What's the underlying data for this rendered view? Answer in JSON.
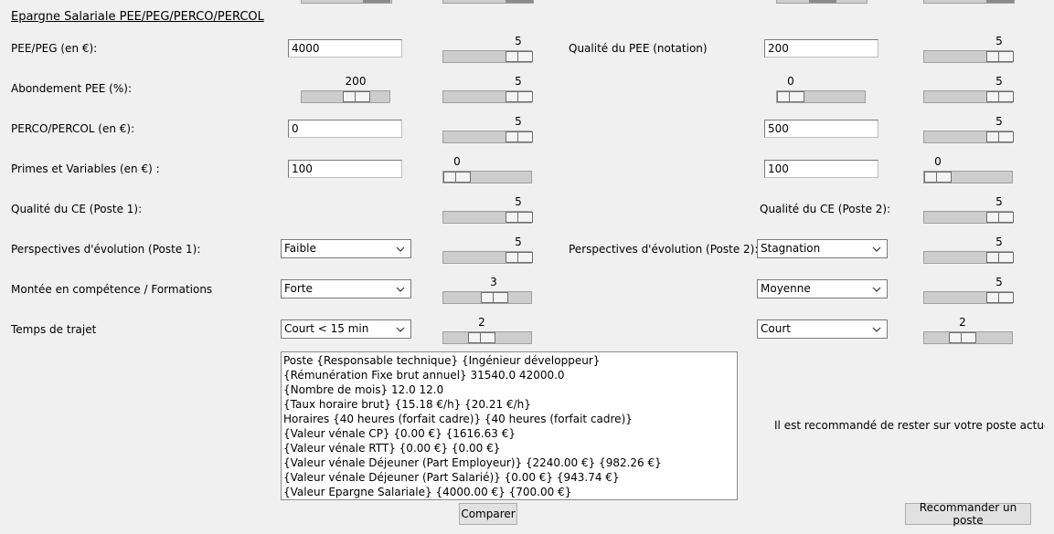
{
  "section_title": "Epargne Salariale PEE/PEG/PERCO/PERCOL",
  "rows": {
    "pee": {
      "label_left": "PEE/PEG (en €):",
      "entry_left": "4000",
      "scale_left_value": "5",
      "label_right": "Qualité du PEE (notation)",
      "entry_right": "200",
      "scale_right_value": "5"
    },
    "abondement": {
      "label_left": "Abondement PEE (%):",
      "scale_abond_value": "200",
      "scale_left_value": "5",
      "scale_right_abond_value": "0",
      "scale_right_value": "5"
    },
    "perco": {
      "label_left": "PERCO/PERCOL (en €):",
      "entry_left": "0",
      "scale_left_value": "5",
      "entry_right": "500",
      "scale_right_value": "5"
    },
    "primes": {
      "label_left": "Primes et Variables (en €) :",
      "entry_left": "100",
      "scale_left_value": "0",
      "entry_right": "100",
      "scale_right_value": "0"
    },
    "ce": {
      "label_left": "Qualité du CE (Poste 1):",
      "scale_left_value": "5",
      "label_right": "Qualité du CE (Poste 2):",
      "scale_right_value": "5"
    },
    "perspectives": {
      "label_left": "Perspectives d'évolution (Poste 1):",
      "combo_left": "Faible",
      "scale_left_value": "5",
      "label_right": "Perspectives d'évolution (Poste 2):",
      "combo_right": "Stagnation",
      "scale_right_value": "5"
    },
    "competence": {
      "label_left": "Montée en compétence / Formations",
      "combo_left": "Forte",
      "scale_left_value": "3",
      "combo_right": "Moyenne",
      "scale_right_value": "5"
    },
    "trajet": {
      "label_left": "Temps de trajet",
      "combo_left": "Court < 15 min",
      "scale_left_value": "2",
      "combo_right": "Court",
      "scale_right_value": "2"
    }
  },
  "results": [
    "Poste {Responsable technique} {Ingénieur développeur}",
    "{Rémunération Fixe brut annuel} 31540.0 42000.0",
    "{Nombre de mois} 12.0 12.0",
    "{Taux horaire brut} {15.18 €/h} {20.21 €/h}",
    "Horaires {40 heures (forfait cadre)} {40 heures (forfait cadre)}",
    "{Valeur vénale CP} {0.00 €} {1616.63 €}",
    "{Valeur vénale RTT} {0.00 €} {0.00 €}",
    "{Valeur vénale Déjeuner (Part Employeur)} {2240.00 €} {982.26 €}",
    "{Valeur vénale Déjeuner (Part Salarié)} {0.00 €} {943.74 €}",
    "{Valeur Epargne Salariale} {4000.00 €} {700.00 €}"
  ],
  "recommendation": "Il est recommandé de rester sur votre poste actuel",
  "buttons": {
    "compare": "Comparer",
    "recommend": "Recommander un poste"
  },
  "icons": {
    "combo_arrow": "chevron-down-icon"
  }
}
